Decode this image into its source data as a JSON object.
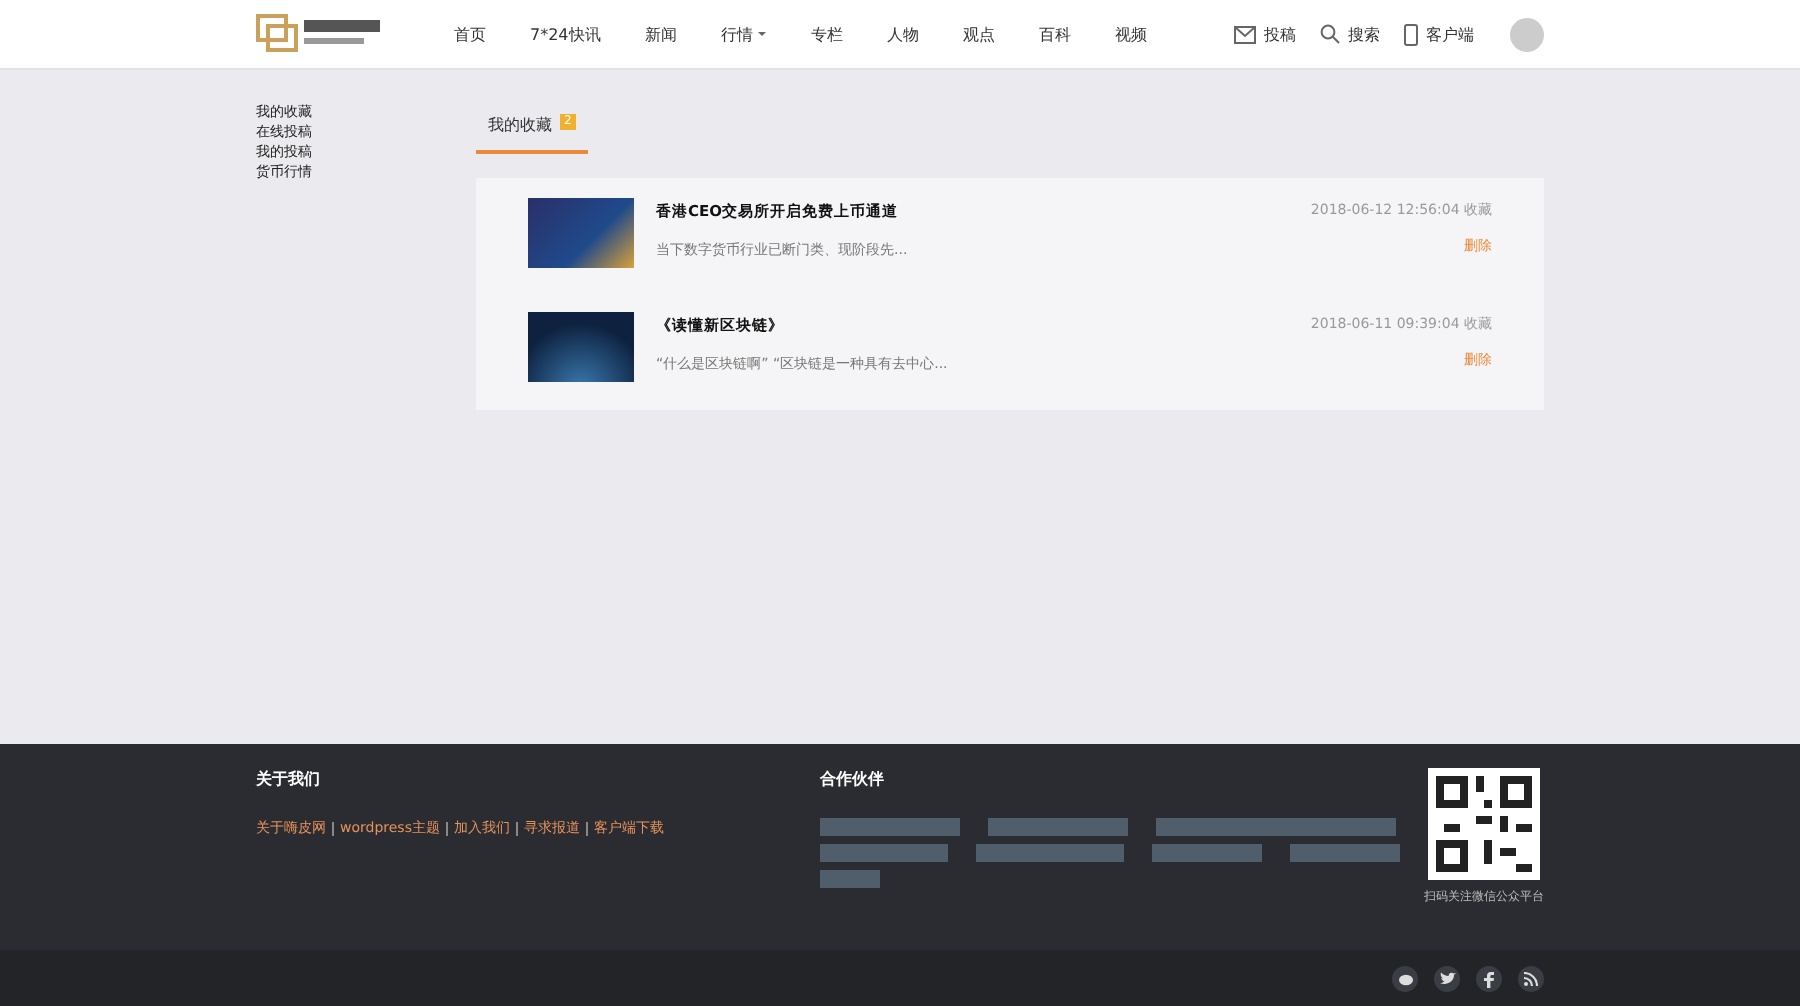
{
  "header": {
    "nav": [
      {
        "label": "首页",
        "selected": false,
        "dropdown": false
      },
      {
        "label": "7*24快讯",
        "selected": false,
        "dropdown": false
      },
      {
        "label": "新闻",
        "selected": false,
        "dropdown": false
      },
      {
        "label": "行情",
        "selected": false,
        "dropdown": true
      },
      {
        "label": "专栏",
        "selected": false,
        "dropdown": false
      },
      {
        "label": "人物",
        "selected": false,
        "dropdown": false
      },
      {
        "label": "观点",
        "selected": false,
        "dropdown": false
      },
      {
        "label": "百科",
        "selected": false,
        "dropdown": false
      },
      {
        "label": "视频",
        "selected": false,
        "dropdown": false
      }
    ],
    "actions": [
      {
        "kind": "mail",
        "label": "投稿"
      },
      {
        "kind": "search",
        "label": "搜索"
      },
      {
        "kind": "phone",
        "label": "客户端"
      }
    ]
  },
  "sidebar": {
    "items": [
      "我的收藏",
      "在线投稿",
      "我的投稿",
      "货币行情"
    ]
  },
  "tabs": [
    {
      "label": "我的收藏",
      "badge": "2",
      "selected": true
    }
  ],
  "favorites": [
    {
      "title": "香港CEO交易所开启免费上币通道",
      "excerpt": "当下数字货币行业已断门类、现阶段先...",
      "date": "2018-06-12 12:56:04 收藏",
      "action": "删除"
    },
    {
      "title": "《读懂新区块链》",
      "excerpt": "“什么是区块链啊” “区块链是一种具有去中心...",
      "date": "2018-06-11 09:39:04 收藏",
      "action": "删除"
    }
  ],
  "footer": {
    "about": {
      "title": "关于我们",
      "links": [
        "关于嗨皮网",
        "wordpress主题",
        "加入我们",
        "寻求报道",
        "客户端下载"
      ]
    },
    "partners": {
      "title": "合作伙伴"
    },
    "qr_caption": "扫码关注微信公众平台"
  }
}
